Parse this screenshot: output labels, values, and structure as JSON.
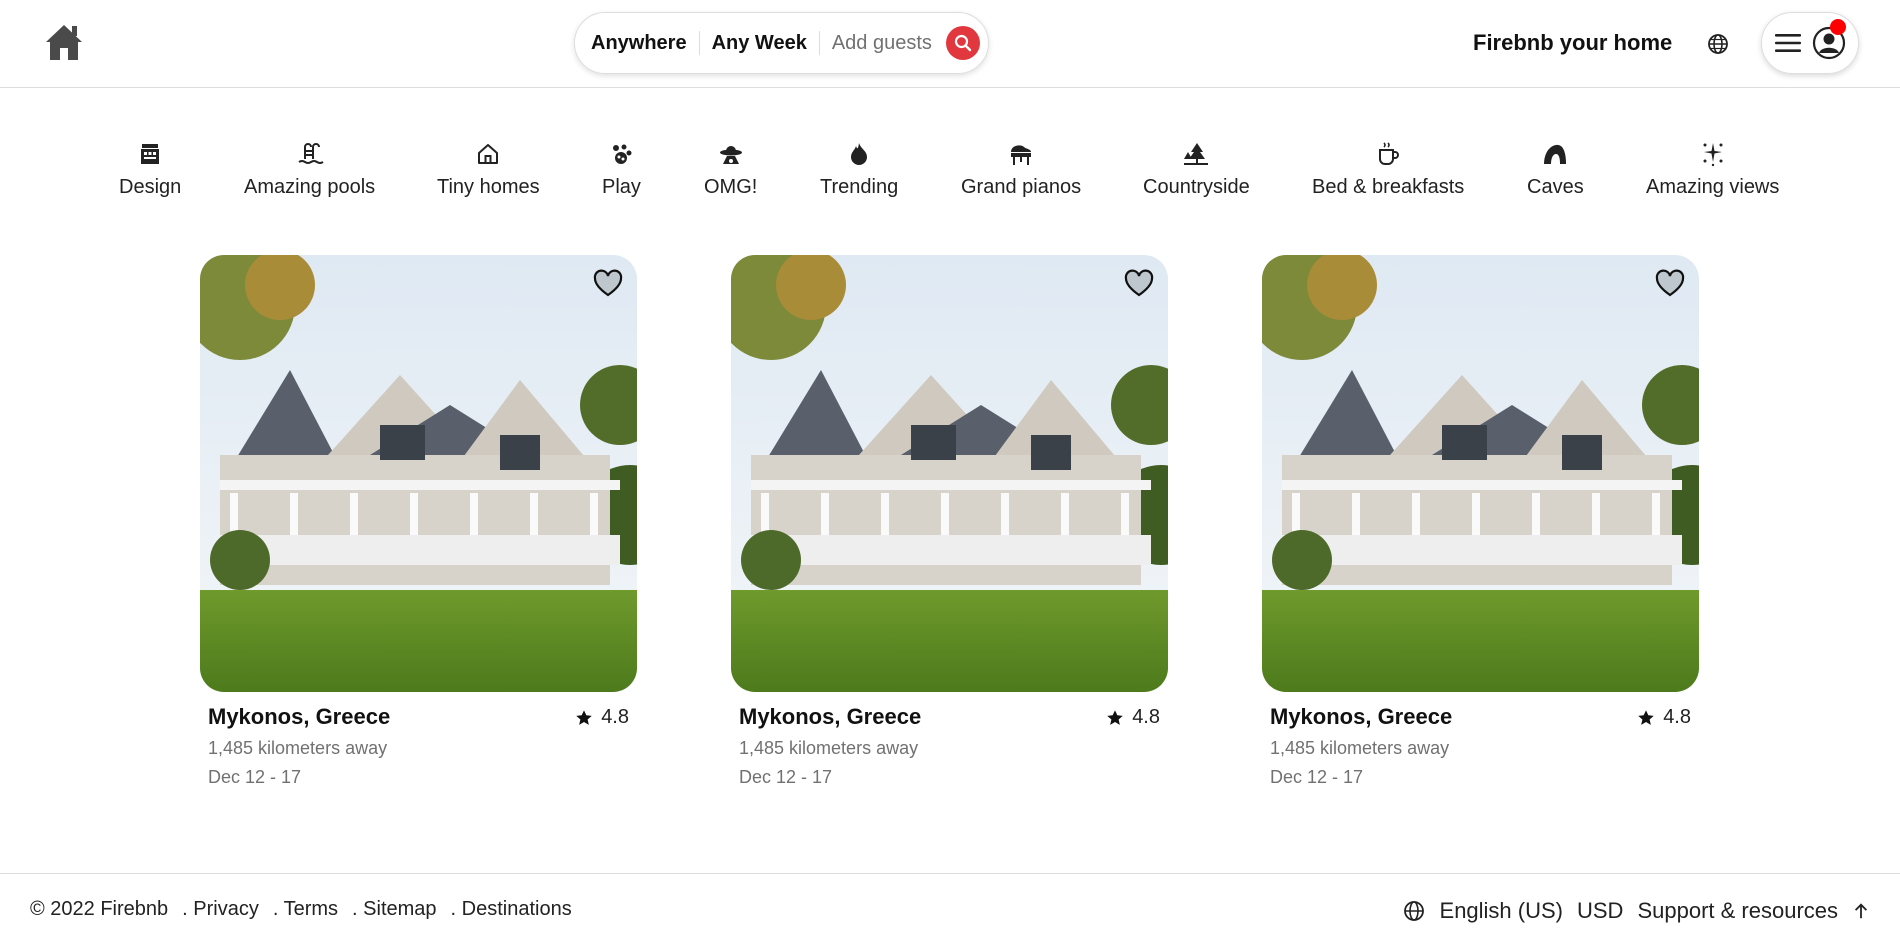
{
  "header": {
    "logo_icon": "home-icon",
    "search": {
      "location": "Anywhere",
      "week": "Any Week",
      "guests": "Add guests",
      "search_icon": "search-icon"
    },
    "host_link": "Firebnb your home",
    "globe_icon": "globe-icon",
    "menu_icon": "hamburger-menu-icon",
    "avatar_icon": "user-avatar-icon",
    "notification_color": "#ff0000"
  },
  "categories": [
    {
      "label": "Design",
      "icon": "design-building-icon"
    },
    {
      "label": "Amazing pools",
      "icon": "pool-icon"
    },
    {
      "label": "Tiny homes",
      "icon": "tiny-home-icon"
    },
    {
      "label": "Play",
      "icon": "play-icon"
    },
    {
      "label": "OMG!",
      "icon": "ufo-icon"
    },
    {
      "label": "Trending",
      "icon": "flame-icon"
    },
    {
      "label": "Grand pianos",
      "icon": "piano-icon"
    },
    {
      "label": "Countryside",
      "icon": "trees-icon"
    },
    {
      "label": "Bed & breakfasts",
      "icon": "coffee-cup-icon"
    },
    {
      "label": "Caves",
      "icon": "cave-icon"
    },
    {
      "label": "Amazing views",
      "icon": "sparkle-view-icon"
    }
  ],
  "listings": [
    {
      "title": "Mykonos, Greece",
      "rating": "4.8",
      "distance": "1,485 kilometers away",
      "dates": "Dec 12 - 17"
    },
    {
      "title": "Mykonos, Greece",
      "rating": "4.8",
      "distance": "1,485 kilometers away",
      "dates": "Dec 12 - 17"
    },
    {
      "title": "Mykonos, Greece",
      "rating": "4.8",
      "distance": "1,485 kilometers away",
      "dates": "Dec 12 - 17"
    }
  ],
  "footer": {
    "copyright": "© 2022 Firebnb",
    "links": [
      ". Privacy",
      ". Terms",
      ". Sitemap",
      ". Destinations"
    ],
    "language": "English (US)",
    "currency": "USD",
    "support": "Support & resources"
  },
  "colors": {
    "accent": "#e0383e",
    "border": "#dddddd",
    "muted_text": "#717171"
  }
}
